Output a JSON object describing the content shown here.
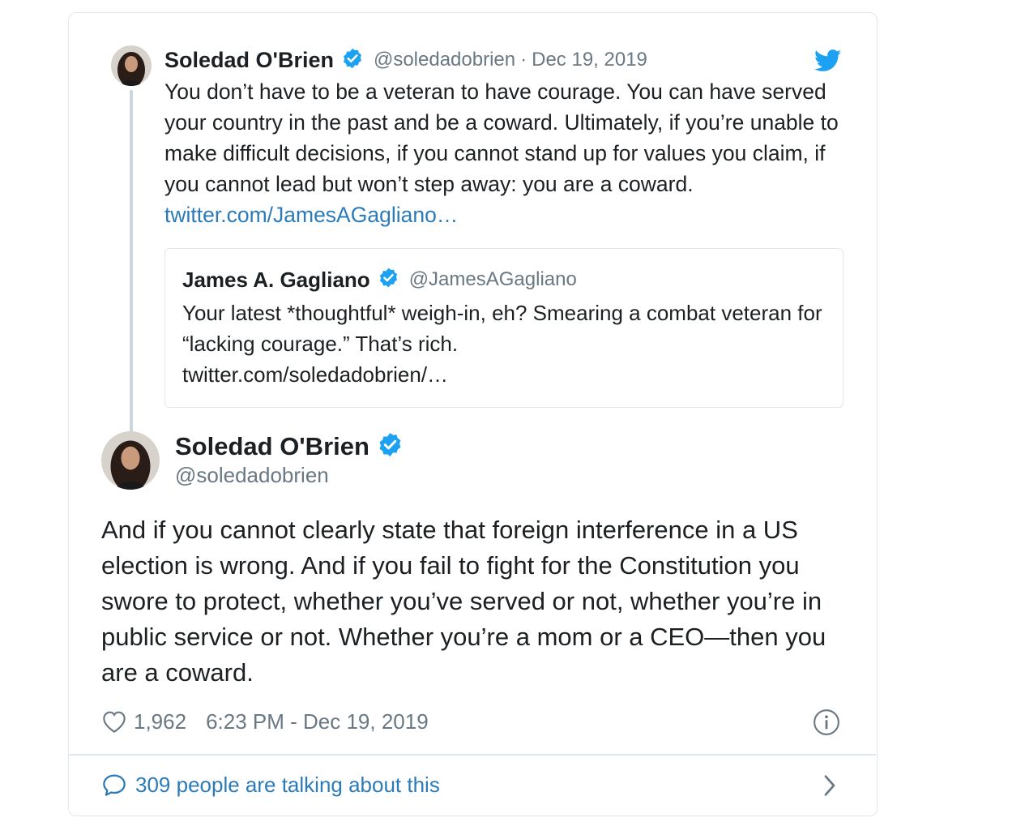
{
  "parent_tweet": {
    "author_name": "Soledad O'Brien",
    "handle": "@soledadobrien",
    "separator": "·",
    "date": "Dec 19, 2019",
    "text": "You don’t have to be a veteran to have courage. You can have served your country in the past and be a coward. Ultimately, if you’re unable to make difficult decisions, if you cannot stand up for values you claim, if you cannot lead but won’t step away: you are a coward.",
    "link": "twitter.com/JamesAGagliano…",
    "avatar_icon": "person-photo-icon",
    "verified_icon": "verified-badge-icon"
  },
  "quoted_tweet": {
    "author_name": "James A. Gagliano",
    "handle": "@JamesAGagliano",
    "text": "Your latest *thoughtful* weigh-in, eh? Smearing a combat veteran for “lacking courage.” That’s rich.",
    "link": "twitter.com/soledadobrien/…"
  },
  "main_tweet": {
    "author_name": "Soledad O'Brien",
    "handle": "@soledadobrien",
    "text": "And if you cannot clearly state that foreign interference in a US election is wrong. And if you fail to fight for the Constitution you swore to protect, whether you’ve served or not, whether you’re in public service or not. Whether you’re a mom or a CEO—then you are a coward.",
    "likes": "1,962",
    "timestamp": "6:23 PM - Dec 19, 2019"
  },
  "footer": {
    "talking_label": "309 people are talking about this"
  },
  "colors": {
    "accent": "#1da1f2",
    "link": "#2b7bb9",
    "muted": "#697882",
    "border": "#e1e8ed"
  }
}
